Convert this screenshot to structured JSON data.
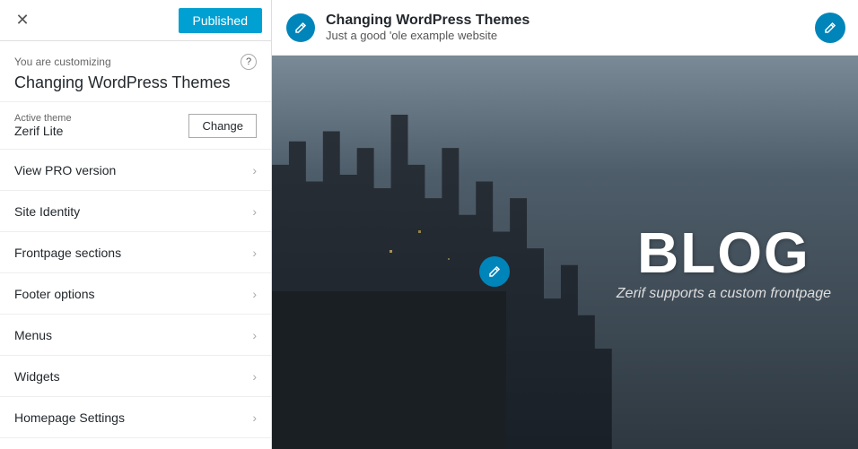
{
  "header": {
    "close_label": "✕",
    "published_label": "Published"
  },
  "customizing": {
    "label": "You are customizing",
    "site_title": "Changing WordPress Themes",
    "help_icon": "?"
  },
  "theme": {
    "active_label": "Active theme",
    "theme_name": "Zerif Lite",
    "change_label": "Change"
  },
  "menu": {
    "items": [
      {
        "label": "View PRO version"
      },
      {
        "label": "Site Identity"
      },
      {
        "label": "Frontpage sections"
      },
      {
        "label": "Footer options"
      },
      {
        "label": "Menus"
      },
      {
        "label": "Widgets"
      },
      {
        "label": "Homepage Settings"
      }
    ]
  },
  "preview": {
    "site_title": "Changing WordPress Themes",
    "site_tagline": "Just a good 'ole example website",
    "edit_icon": "✎",
    "blog_title": "BLOG",
    "blog_subtitle": "Zerif supports a custom frontpage"
  }
}
